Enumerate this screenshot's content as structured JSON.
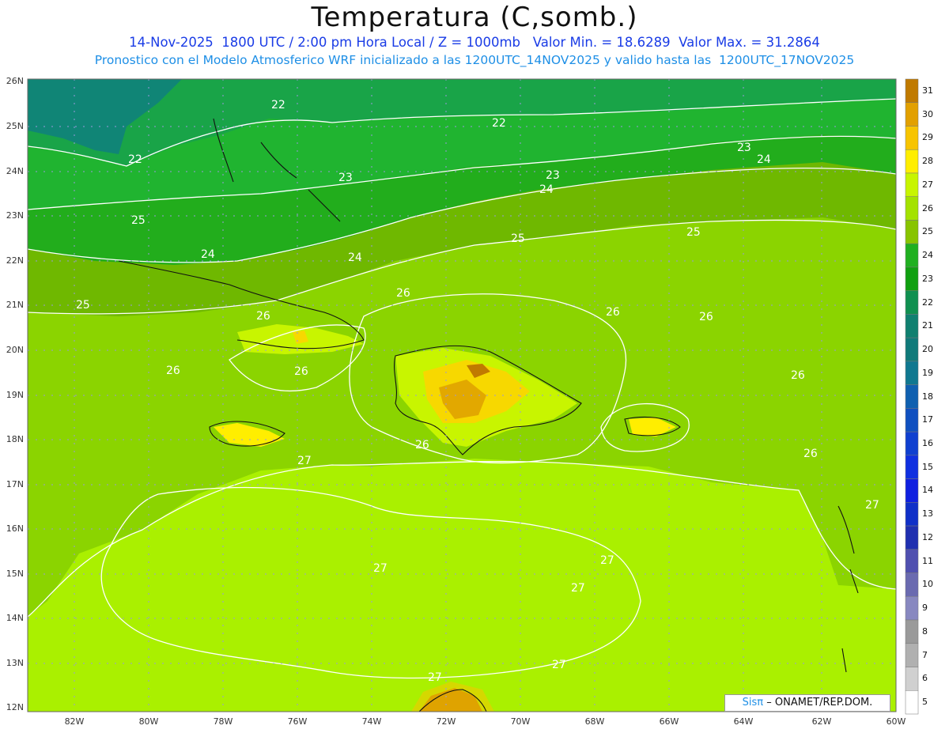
{
  "header": {
    "title": "Temperatura (C,somb.)",
    "line1": "14-Nov-2025  1800 UTC / 2:00 pm Hora Local / Z = 1000mb   Valor Min. = 18.6289  Valor Max. = 31.2864",
    "line2": "Pronostico con el Modelo Atmosferico WRF inicializado a las 1200UTC_14NOV2025 y valido hasta las  1200UTC_17NOV2025"
  },
  "axes": {
    "lat_labels": [
      "26N",
      "25N",
      "24N",
      "23N",
      "22N",
      "21N",
      "20N",
      "19N",
      "18N",
      "17N",
      "16N",
      "15N",
      "14N",
      "13N",
      "12N"
    ],
    "lon_labels": [
      "82W",
      "80W",
      "78W",
      "76W",
      "74W",
      "72W",
      "70W",
      "68W",
      "66W",
      "64W",
      "62W",
      "60W"
    ]
  },
  "colorbar": {
    "levels": [
      "31",
      "30",
      "29",
      "28",
      "27",
      "26",
      "25",
      "24",
      "23",
      "22",
      "21",
      "20",
      "19",
      "18",
      "17",
      "16",
      "15",
      "14",
      "13",
      "12",
      "11",
      "10",
      "9",
      "8",
      "7",
      "6",
      "5"
    ],
    "colors": [
      "#c07a00",
      "#e2a000",
      "#f7c400",
      "#ffee00",
      "#c8f500",
      "#a4e200",
      "#88c400",
      "#20b020",
      "#10a010",
      "#109050",
      "#108070",
      "#107a7a",
      "#107890",
      "#1060b0",
      "#1050c0",
      "#1040d0",
      "#1030e0",
      "#1020e0",
      "#1030c8",
      "#2030b0",
      "#5050b0",
      "#6a6ab0",
      "#8888c0",
      "#9a9a9a",
      "#b0b0b0",
      "#d0d0d0",
      "#ffffff"
    ]
  },
  "contour_labels": [
    "22",
    "22",
    "22",
    "23",
    "23",
    "23",
    "24",
    "24",
    "24",
    "24",
    "25",
    "25",
    "25",
    "25",
    "26",
    "26",
    "26",
    "26",
    "26",
    "26",
    "26",
    "26",
    "26",
    "27",
    "27",
    "27",
    "27",
    "27",
    "27",
    "27"
  ],
  "credit": {
    "sis": "Sisπ",
    "org": "– ONAMET/REP.DOM."
  }
}
